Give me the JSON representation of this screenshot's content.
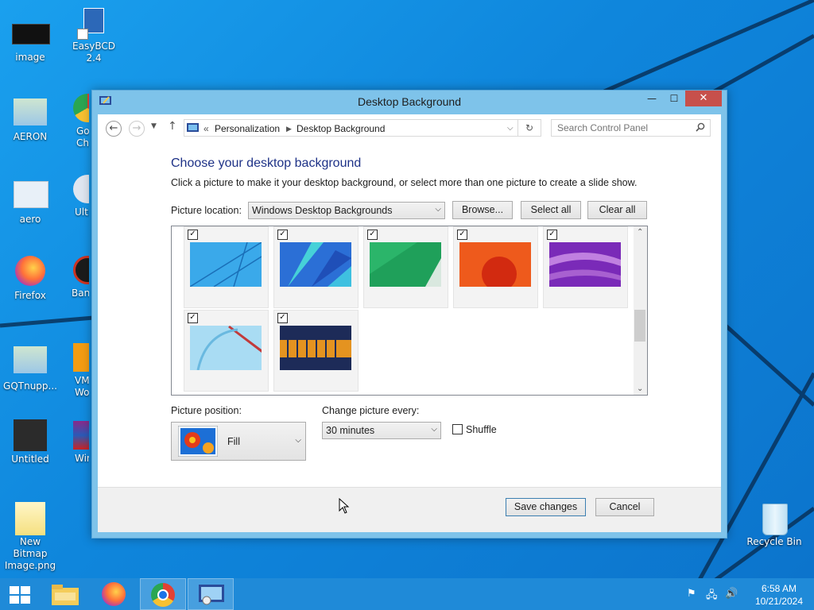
{
  "desktop": {
    "icons": [
      {
        "label": "image"
      },
      {
        "label": "EasyBCD 2.4"
      },
      {
        "label": "AERON"
      },
      {
        "label": "Go\nChr"
      },
      {
        "label": "aero"
      },
      {
        "label": "Ultr"
      },
      {
        "label": "Firefox"
      },
      {
        "label": "Band"
      },
      {
        "label": "GQTnupp..."
      },
      {
        "label": "VM\nWork"
      },
      {
        "label": "Untitled"
      },
      {
        "label": "Win"
      },
      {
        "label": "New Bitmap\nImage.png"
      },
      {
        "label": "Recycle Bin"
      }
    ]
  },
  "window": {
    "title": "Desktop Background",
    "controls": {
      "minimize": "—",
      "maximize": "☐",
      "close": "✕"
    }
  },
  "nav": {
    "back": "←",
    "forward": "→",
    "up": "↑",
    "breadcrumb_prefix": "«",
    "breadcrumb": [
      "Personalization",
      "Desktop Background"
    ],
    "search_placeholder": "Search Control Panel"
  },
  "content": {
    "heading": "Choose your desktop background",
    "description": "Click a picture to make it your desktop background, or select more than one picture to create a slide show.",
    "picture_location_label": "Picture location:",
    "picture_location_value": "Windows Desktop Backgrounds",
    "browse_label": "Browse...",
    "select_all_label": "Select all",
    "clear_all_label": "Clear all",
    "wallpapers": [
      {
        "checked": true,
        "colors": [
          "#47b4ea",
          "#1e86d0"
        ]
      },
      {
        "checked": true,
        "colors": [
          "#2b6fd6",
          "#46d1d8"
        ]
      },
      {
        "checked": true,
        "colors": [
          "#1fa05a",
          "#0f7a44"
        ]
      },
      {
        "checked": true,
        "colors": [
          "#ee5a1c",
          "#d22a10"
        ]
      },
      {
        "checked": true,
        "colors": [
          "#7a2ab8",
          "#c080e0"
        ]
      },
      {
        "checked": true,
        "colors": [
          "#a9dcf3",
          "#6ab9e0"
        ]
      },
      {
        "checked": true,
        "colors": [
          "#1d2b58",
          "#e49320"
        ]
      }
    ],
    "picture_position_label": "Picture position:",
    "picture_position_value": "Fill",
    "change_picture_label": "Change picture every:",
    "change_picture_value": "30 minutes",
    "shuffle_label": "Shuffle",
    "shuffle_checked": false,
    "save_label": "Save changes",
    "cancel_label": "Cancel"
  },
  "taskbar": {
    "time": "6:58 AM",
    "date": "10/21/2024"
  }
}
